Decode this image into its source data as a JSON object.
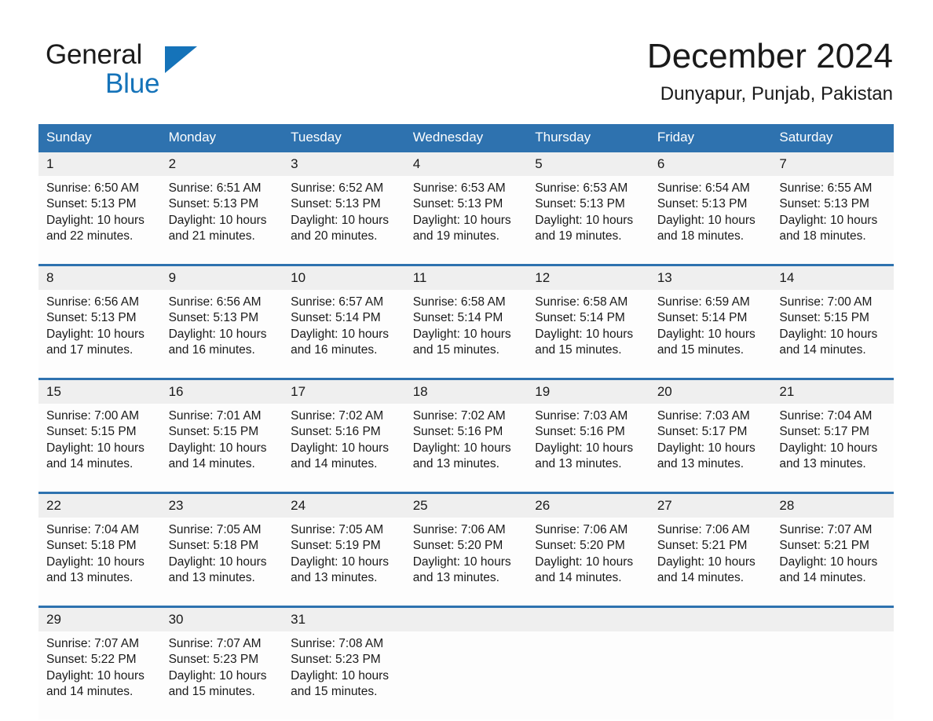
{
  "brand": {
    "line1": "General",
    "line2": "Blue",
    "accent_color": "#1573b9",
    "triangle_icon": "right-triangle-icon"
  },
  "header": {
    "title": "December 2024",
    "subtitle": "Dunyapur, Punjab, Pakistan"
  },
  "theme": {
    "header_blue": "#2e72af",
    "row_divider_blue": "#2e72af",
    "daynum_band": "#efefef",
    "text": "#1a1a1a"
  },
  "calendar": {
    "weekday_headers": [
      "Sunday",
      "Monday",
      "Tuesday",
      "Wednesday",
      "Thursday",
      "Friday",
      "Saturday"
    ],
    "weeks": [
      {
        "days": [
          {
            "date": "1",
            "sunrise": "Sunrise: 6:50 AM",
            "sunset": "Sunset: 5:13 PM",
            "daylight_1": "Daylight: 10 hours",
            "daylight_2": "and 22 minutes."
          },
          {
            "date": "2",
            "sunrise": "Sunrise: 6:51 AM",
            "sunset": "Sunset: 5:13 PM",
            "daylight_1": "Daylight: 10 hours",
            "daylight_2": "and 21 minutes."
          },
          {
            "date": "3",
            "sunrise": "Sunrise: 6:52 AM",
            "sunset": "Sunset: 5:13 PM",
            "daylight_1": "Daylight: 10 hours",
            "daylight_2": "and 20 minutes."
          },
          {
            "date": "4",
            "sunrise": "Sunrise: 6:53 AM",
            "sunset": "Sunset: 5:13 PM",
            "daylight_1": "Daylight: 10 hours",
            "daylight_2": "and 19 minutes."
          },
          {
            "date": "5",
            "sunrise": "Sunrise: 6:53 AM",
            "sunset": "Sunset: 5:13 PM",
            "daylight_1": "Daylight: 10 hours",
            "daylight_2": "and 19 minutes."
          },
          {
            "date": "6",
            "sunrise": "Sunrise: 6:54 AM",
            "sunset": "Sunset: 5:13 PM",
            "daylight_1": "Daylight: 10 hours",
            "daylight_2": "and 18 minutes."
          },
          {
            "date": "7",
            "sunrise": "Sunrise: 6:55 AM",
            "sunset": "Sunset: 5:13 PM",
            "daylight_1": "Daylight: 10 hours",
            "daylight_2": "and 18 minutes."
          }
        ]
      },
      {
        "days": [
          {
            "date": "8",
            "sunrise": "Sunrise: 6:56 AM",
            "sunset": "Sunset: 5:13 PM",
            "daylight_1": "Daylight: 10 hours",
            "daylight_2": "and 17 minutes."
          },
          {
            "date": "9",
            "sunrise": "Sunrise: 6:56 AM",
            "sunset": "Sunset: 5:13 PM",
            "daylight_1": "Daylight: 10 hours",
            "daylight_2": "and 16 minutes."
          },
          {
            "date": "10",
            "sunrise": "Sunrise: 6:57 AM",
            "sunset": "Sunset: 5:14 PM",
            "daylight_1": "Daylight: 10 hours",
            "daylight_2": "and 16 minutes."
          },
          {
            "date": "11",
            "sunrise": "Sunrise: 6:58 AM",
            "sunset": "Sunset: 5:14 PM",
            "daylight_1": "Daylight: 10 hours",
            "daylight_2": "and 15 minutes."
          },
          {
            "date": "12",
            "sunrise": "Sunrise: 6:58 AM",
            "sunset": "Sunset: 5:14 PM",
            "daylight_1": "Daylight: 10 hours",
            "daylight_2": "and 15 minutes."
          },
          {
            "date": "13",
            "sunrise": "Sunrise: 6:59 AM",
            "sunset": "Sunset: 5:14 PM",
            "daylight_1": "Daylight: 10 hours",
            "daylight_2": "and 15 minutes."
          },
          {
            "date": "14",
            "sunrise": "Sunrise: 7:00 AM",
            "sunset": "Sunset: 5:15 PM",
            "daylight_1": "Daylight: 10 hours",
            "daylight_2": "and 14 minutes."
          }
        ]
      },
      {
        "days": [
          {
            "date": "15",
            "sunrise": "Sunrise: 7:00 AM",
            "sunset": "Sunset: 5:15 PM",
            "daylight_1": "Daylight: 10 hours",
            "daylight_2": "and 14 minutes."
          },
          {
            "date": "16",
            "sunrise": "Sunrise: 7:01 AM",
            "sunset": "Sunset: 5:15 PM",
            "daylight_1": "Daylight: 10 hours",
            "daylight_2": "and 14 minutes."
          },
          {
            "date": "17",
            "sunrise": "Sunrise: 7:02 AM",
            "sunset": "Sunset: 5:16 PM",
            "daylight_1": "Daylight: 10 hours",
            "daylight_2": "and 14 minutes."
          },
          {
            "date": "18",
            "sunrise": "Sunrise: 7:02 AM",
            "sunset": "Sunset: 5:16 PM",
            "daylight_1": "Daylight: 10 hours",
            "daylight_2": "and 13 minutes."
          },
          {
            "date": "19",
            "sunrise": "Sunrise: 7:03 AM",
            "sunset": "Sunset: 5:16 PM",
            "daylight_1": "Daylight: 10 hours",
            "daylight_2": "and 13 minutes."
          },
          {
            "date": "20",
            "sunrise": "Sunrise: 7:03 AM",
            "sunset": "Sunset: 5:17 PM",
            "daylight_1": "Daylight: 10 hours",
            "daylight_2": "and 13 minutes."
          },
          {
            "date": "21",
            "sunrise": "Sunrise: 7:04 AM",
            "sunset": "Sunset: 5:17 PM",
            "daylight_1": "Daylight: 10 hours",
            "daylight_2": "and 13 minutes."
          }
        ]
      },
      {
        "days": [
          {
            "date": "22",
            "sunrise": "Sunrise: 7:04 AM",
            "sunset": "Sunset: 5:18 PM",
            "daylight_1": "Daylight: 10 hours",
            "daylight_2": "and 13 minutes."
          },
          {
            "date": "23",
            "sunrise": "Sunrise: 7:05 AM",
            "sunset": "Sunset: 5:18 PM",
            "daylight_1": "Daylight: 10 hours",
            "daylight_2": "and 13 minutes."
          },
          {
            "date": "24",
            "sunrise": "Sunrise: 7:05 AM",
            "sunset": "Sunset: 5:19 PM",
            "daylight_1": "Daylight: 10 hours",
            "daylight_2": "and 13 minutes."
          },
          {
            "date": "25",
            "sunrise": "Sunrise: 7:06 AM",
            "sunset": "Sunset: 5:20 PM",
            "daylight_1": "Daylight: 10 hours",
            "daylight_2": "and 13 minutes."
          },
          {
            "date": "26",
            "sunrise": "Sunrise: 7:06 AM",
            "sunset": "Sunset: 5:20 PM",
            "daylight_1": "Daylight: 10 hours",
            "daylight_2": "and 14 minutes."
          },
          {
            "date": "27",
            "sunrise": "Sunrise: 7:06 AM",
            "sunset": "Sunset: 5:21 PM",
            "daylight_1": "Daylight: 10 hours",
            "daylight_2": "and 14 minutes."
          },
          {
            "date": "28",
            "sunrise": "Sunrise: 7:07 AM",
            "sunset": "Sunset: 5:21 PM",
            "daylight_1": "Daylight: 10 hours",
            "daylight_2": "and 14 minutes."
          }
        ]
      },
      {
        "days": [
          {
            "date": "29",
            "sunrise": "Sunrise: 7:07 AM",
            "sunset": "Sunset: 5:22 PM",
            "daylight_1": "Daylight: 10 hours",
            "daylight_2": "and 14 minutes."
          },
          {
            "date": "30",
            "sunrise": "Sunrise: 7:07 AM",
            "sunset": "Sunset: 5:23 PM",
            "daylight_1": "Daylight: 10 hours",
            "daylight_2": "and 15 minutes."
          },
          {
            "date": "31",
            "sunrise": "Sunrise: 7:08 AM",
            "sunset": "Sunset: 5:23 PM",
            "daylight_1": "Daylight: 10 hours",
            "daylight_2": "and 15 minutes."
          },
          {
            "date": "",
            "sunrise": "",
            "sunset": "",
            "daylight_1": "",
            "daylight_2": ""
          },
          {
            "date": "",
            "sunrise": "",
            "sunset": "",
            "daylight_1": "",
            "daylight_2": ""
          },
          {
            "date": "",
            "sunrise": "",
            "sunset": "",
            "daylight_1": "",
            "daylight_2": ""
          },
          {
            "date": "",
            "sunrise": "",
            "sunset": "",
            "daylight_1": "",
            "daylight_2": ""
          }
        ]
      }
    ]
  }
}
